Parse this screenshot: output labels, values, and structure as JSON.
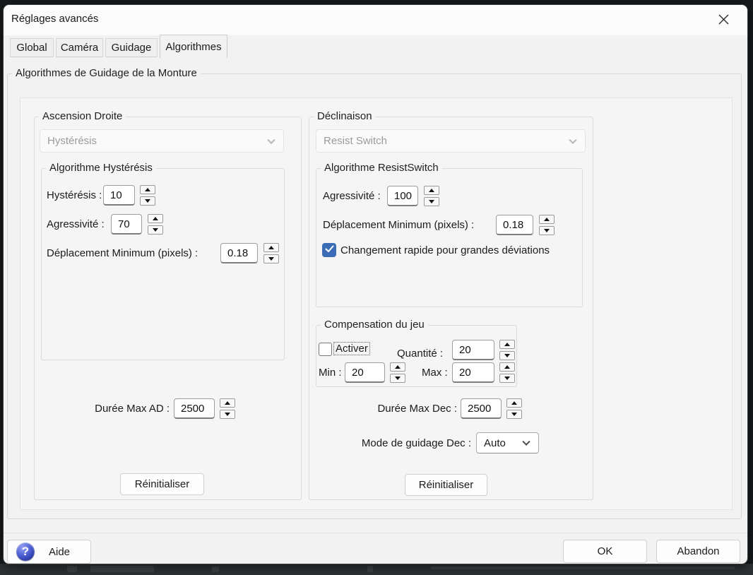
{
  "window": {
    "title": "Réglages avancés"
  },
  "tabs": [
    {
      "label": "Global",
      "active": false
    },
    {
      "label": "Caméra",
      "active": false
    },
    {
      "label": "Guidage",
      "active": false
    },
    {
      "label": "Algorithmes",
      "active": true
    }
  ],
  "mount_group_label": "Algorithmes de Guidage de la Monture",
  "ra": {
    "group_label": "Ascension Droite",
    "algorithm_selected": "Hystérésis",
    "inner_group_label": "Algorithme Hystérésis",
    "hysteresis_label": "Hystérésis :",
    "hysteresis_value": "10",
    "aggressiveness_label": "Agressivité :",
    "aggressiveness_value": "70",
    "min_move_label": "Déplacement Minimum (pixels) :",
    "min_move_value": "0.18",
    "max_duration_label": "Durée Max AD :",
    "max_duration_value": "2500",
    "reset_label": "Réinitialiser"
  },
  "dec": {
    "group_label": "Déclinaison",
    "algorithm_selected": "Resist Switch",
    "inner_group_label": "Algorithme ResistSwitch",
    "aggressiveness_label": "Agressivité :",
    "aggressiveness_value": "100",
    "min_move_label": "Déplacement Minimum (pixels) :",
    "min_move_value": "0.18",
    "fast_switch_label": "Changement rapide pour grandes déviations",
    "fast_switch_checked": true,
    "backlash": {
      "group_label": "Compensation du jeu",
      "enable_label": "Activer",
      "enable_checked": false,
      "amount_label": "Quantité :",
      "amount_value": "20",
      "min_label": "Min :",
      "min_value": "20",
      "max_label": "Max :",
      "max_value": "20"
    },
    "max_duration_label": "Durée Max Dec :",
    "max_duration_value": "2500",
    "guide_mode_label": "Mode de guidage Dec :",
    "guide_mode_value": "Auto",
    "reset_label": "Réinitialiser"
  },
  "footer": {
    "help_label": "Aide",
    "ok_label": "OK",
    "cancel_label": "Abandon"
  },
  "colors": {
    "checkbox_accent": "#3a6db6",
    "dialog_bg": "#f2f2f2"
  }
}
